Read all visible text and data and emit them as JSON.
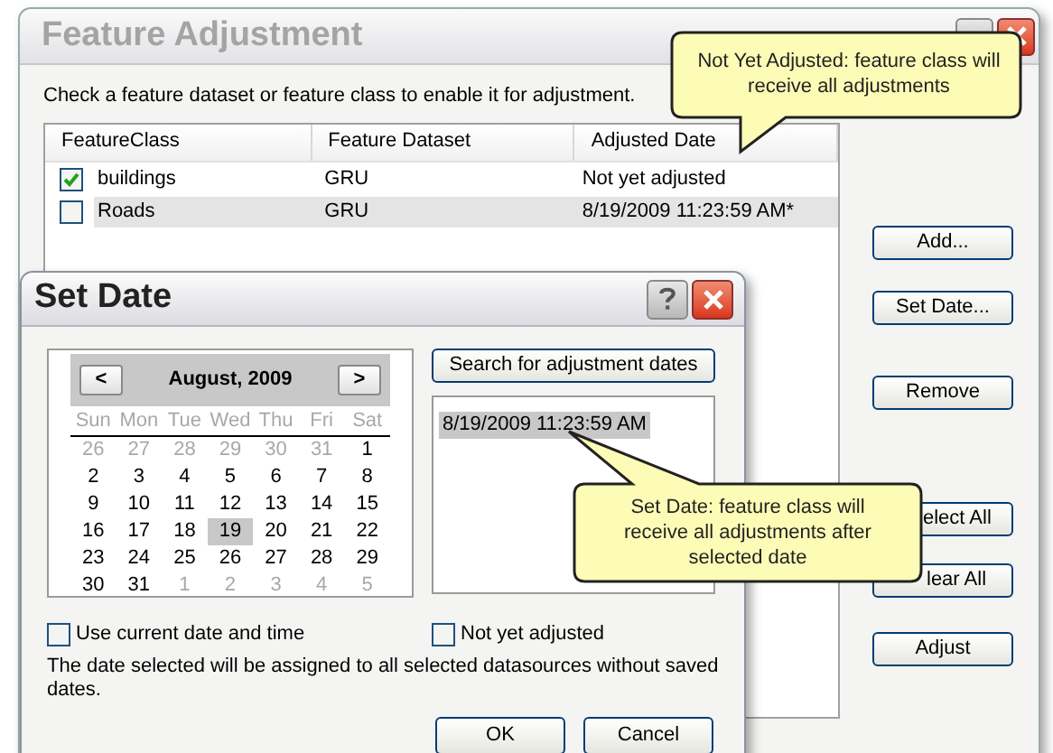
{
  "main_window": {
    "title": "Feature Adjustment",
    "instruction": "Check a feature dataset or feature class to enable it for adjustment.",
    "table": {
      "columns": [
        "FeatureClass",
        "Feature Dataset",
        "Adjusted Date"
      ],
      "rows": [
        {
          "checked": true,
          "selected": false,
          "feature_class": "buildings",
          "dataset": "GRU",
          "date": "Not yet adjusted"
        },
        {
          "checked": false,
          "selected": true,
          "feature_class": "Roads",
          "dataset": "GRU",
          "date": "8/19/2009 11:23:59 AM*"
        }
      ]
    },
    "buttons": [
      "Add...",
      "Set Date...",
      "Remove",
      "elect All",
      "lear All",
      "Adjust"
    ]
  },
  "set_date_dialog": {
    "title": "Set Date",
    "calendar": {
      "month": "August, 2009",
      "prev": "<",
      "next": ">",
      "weekdays": [
        "Sun",
        "Mon",
        "Tue",
        "Wed",
        "Thu",
        "Fri",
        "Sat"
      ],
      "days": [
        {
          "label": "26",
          "outside": true,
          "selected": false
        },
        {
          "label": "27",
          "outside": true,
          "selected": false
        },
        {
          "label": "28",
          "outside": true,
          "selected": false
        },
        {
          "label": "29",
          "outside": true,
          "selected": false
        },
        {
          "label": "30",
          "outside": true,
          "selected": false
        },
        {
          "label": "31",
          "outside": true,
          "selected": false
        },
        {
          "label": "1",
          "outside": false,
          "selected": false
        },
        {
          "label": "2",
          "outside": false,
          "selected": false
        },
        {
          "label": "3",
          "outside": false,
          "selected": false
        },
        {
          "label": "4",
          "outside": false,
          "selected": false
        },
        {
          "label": "5",
          "outside": false,
          "selected": false
        },
        {
          "label": "6",
          "outside": false,
          "selected": false
        },
        {
          "label": "7",
          "outside": false,
          "selected": false
        },
        {
          "label": "8",
          "outside": false,
          "selected": false
        },
        {
          "label": "9",
          "outside": false,
          "selected": false
        },
        {
          "label": "10",
          "outside": false,
          "selected": false
        },
        {
          "label": "11",
          "outside": false,
          "selected": false
        },
        {
          "label": "12",
          "outside": false,
          "selected": false
        },
        {
          "label": "13",
          "outside": false,
          "selected": false
        },
        {
          "label": "14",
          "outside": false,
          "selected": false
        },
        {
          "label": "15",
          "outside": false,
          "selected": false
        },
        {
          "label": "16",
          "outside": false,
          "selected": false
        },
        {
          "label": "17",
          "outside": false,
          "selected": false
        },
        {
          "label": "18",
          "outside": false,
          "selected": false
        },
        {
          "label": "19",
          "outside": false,
          "selected": true
        },
        {
          "label": "20",
          "outside": false,
          "selected": false
        },
        {
          "label": "21",
          "outside": false,
          "selected": false
        },
        {
          "label": "22",
          "outside": false,
          "selected": false
        },
        {
          "label": "23",
          "outside": false,
          "selected": false
        },
        {
          "label": "24",
          "outside": false,
          "selected": false
        },
        {
          "label": "25",
          "outside": false,
          "selected": false
        },
        {
          "label": "26",
          "outside": false,
          "selected": false
        },
        {
          "label": "27",
          "outside": false,
          "selected": false
        },
        {
          "label": "28",
          "outside": false,
          "selected": false
        },
        {
          "label": "29",
          "outside": false,
          "selected": false
        },
        {
          "label": "30",
          "outside": false,
          "selected": false
        },
        {
          "label": "31",
          "outside": false,
          "selected": false
        },
        {
          "label": "1",
          "outside": true,
          "selected": false
        },
        {
          "label": "2",
          "outside": true,
          "selected": false
        },
        {
          "label": "3",
          "outside": true,
          "selected": false
        },
        {
          "label": "4",
          "outside": true,
          "selected": false
        },
        {
          "label": "5",
          "outside": true,
          "selected": false
        }
      ]
    },
    "search_button": "Search for adjustment dates",
    "dates": [
      {
        "label": "8/19/2009 11:23:59 AM",
        "selected": true
      }
    ],
    "use_current": {
      "label": "Use current date and time",
      "checked": false
    },
    "not_yet_adjusted": {
      "label": "Not yet adjusted",
      "checked": false
    },
    "note": "The date selected will be assigned to all selected datasources without saved dates.",
    "buttons": [
      "OK",
      "Cancel"
    ]
  },
  "callouts": [
    "Not Yet Adjusted: feature class will receive all adjustments",
    "Set Date: feature class will receive all adjustments after selected date"
  ]
}
